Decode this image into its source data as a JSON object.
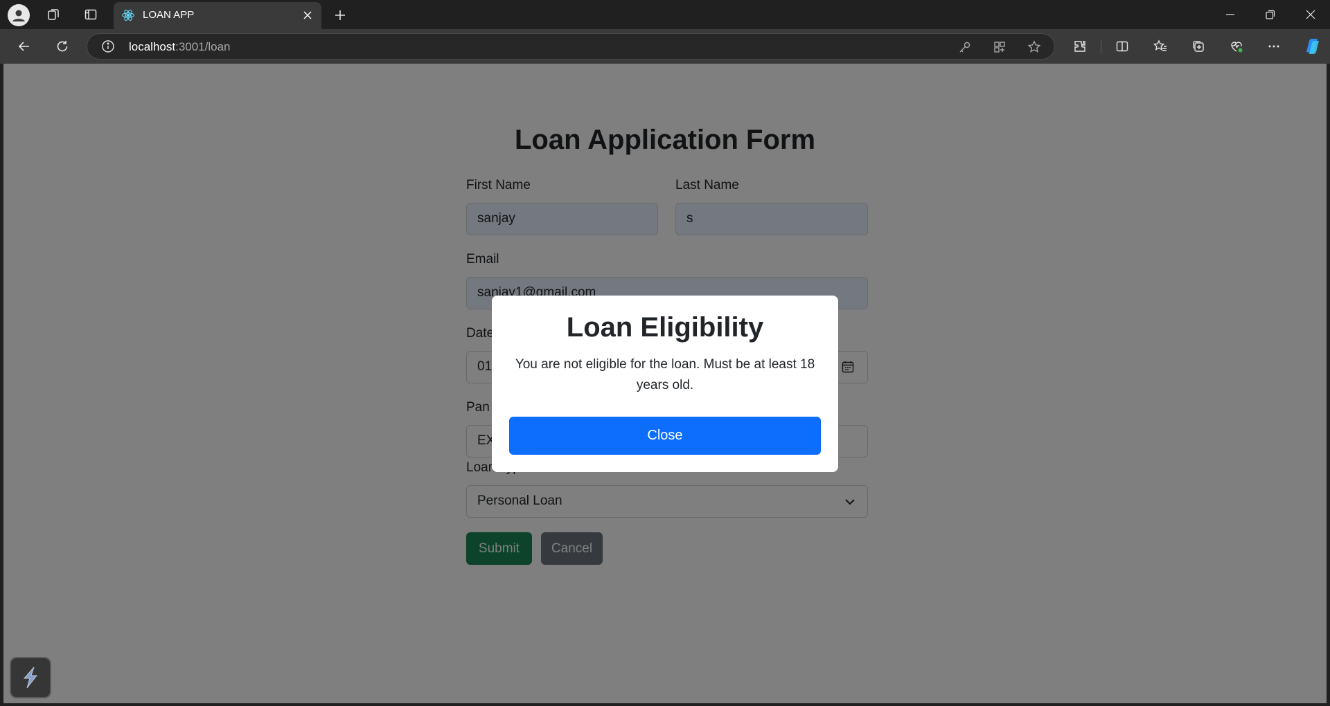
{
  "browser": {
    "tab_title": "LOAN APP",
    "url_host": "localhost",
    "url_rest": ":3001/loan"
  },
  "page": {
    "title": "Loan Application Form",
    "first_name_label": "First Name",
    "first_name_value": "sanjay",
    "last_name_label": "Last Name",
    "last_name_value": "s",
    "email_label": "Email",
    "email_value": "sanjay1@gmail.com",
    "dob_label": "Date",
    "dob_value": "01",
    "pan_label": "Pan",
    "pan_value": "EX",
    "loan_type_label": "Loan Type",
    "loan_type_value": "Personal Loan",
    "submit_label": "Submit",
    "cancel_label": "Cancel"
  },
  "modal": {
    "title": "Loan Eligibility",
    "message": "You are not eligible for the loan. Must be at least 18 years old.",
    "close_label": "Close"
  },
  "colors": {
    "primary": "#0d6efd",
    "success": "#198754",
    "secondary": "#6c757d"
  }
}
